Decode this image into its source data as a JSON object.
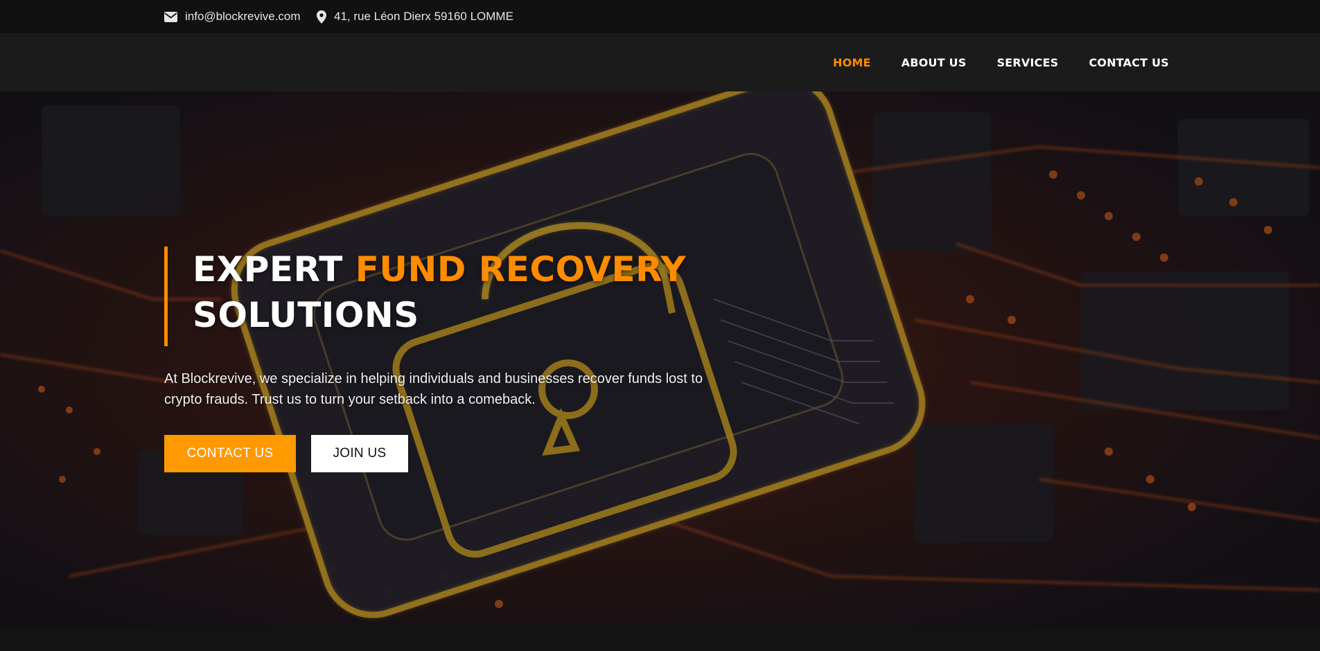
{
  "topbar": {
    "email": "info@blockrevive.com",
    "address": "41, rue Léon Dierx 59160 LOMME",
    "email_icon": "envelope-icon",
    "address_icon": "map-marker-icon"
  },
  "nav": {
    "items": [
      {
        "label": "HOME",
        "active": true
      },
      {
        "label": "ABOUT US",
        "active": false
      },
      {
        "label": "SERVICES",
        "active": false
      },
      {
        "label": "CONTACT US",
        "active": false
      }
    ]
  },
  "hero": {
    "title_part1": "EXPERT ",
    "title_accent": "FUND RECOVERY",
    "title_part2": "SOLUTIONS",
    "description": "At Blockrevive, we specialize in helping individuals and businesses recover funds lost to crypto frauds. Trust us to turn your setback into a comeback.",
    "primary_button": "CONTACT US",
    "secondary_button": "JOIN US",
    "background_icon": "padlock-circuit-board"
  },
  "colors": {
    "accent": "#ff8c00",
    "topbar_bg": "#111111",
    "navbar_bg": "#1b1b1b",
    "button_primary": "#ff9900"
  }
}
